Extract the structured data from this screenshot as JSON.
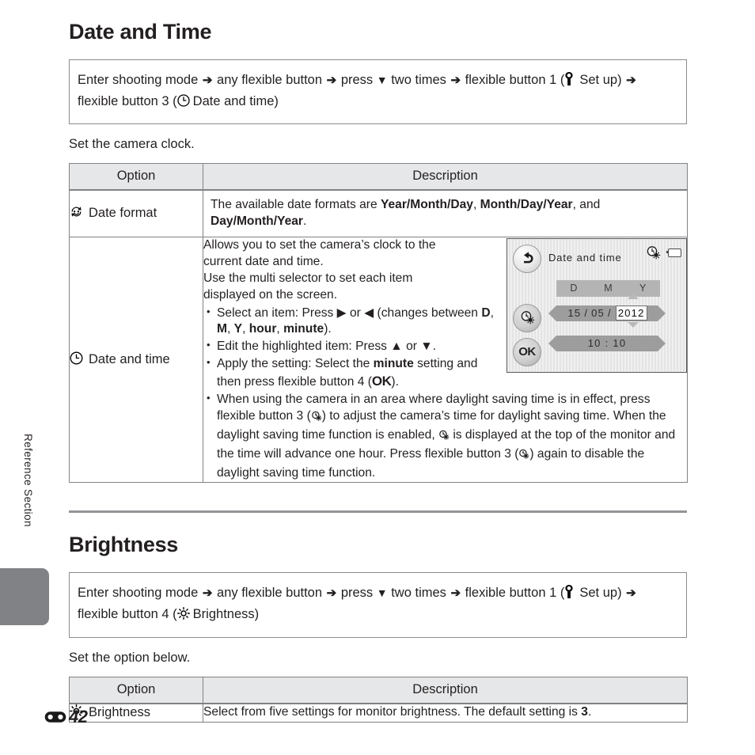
{
  "sidebar": {
    "label": "Reference Section"
  },
  "footer": {
    "section_symbol": "E",
    "page_number": "42"
  },
  "sections": [
    {
      "title": "Date and Time",
      "path": {
        "p1": "Enter shooting mode",
        "p2": "any flexible button",
        "p3": "press",
        "p3b": "two times",
        "p4": "flexible button 1",
        "p5": "Set up)",
        "p5_open": "(",
        "p6": "flexible button 3 (",
        "p7": "Date and time)",
        "arrow": "➔",
        "down_triangle": "▼"
      },
      "lead": "Set the camera clock.",
      "table": {
        "headers": [
          "Option",
          "Description"
        ],
        "rows": [
          {
            "icon": "date-format-icon",
            "option": "Date format",
            "desc_a": "The available date formats are ",
            "desc_b1": "Year/Month/Day",
            "desc_b1_sep": ", ",
            "desc_b2": "Month/Day/Year",
            "desc_b2_sep": ", and ",
            "desc_b3": "Day/Month/Year",
            "desc_end": "."
          },
          {
            "icon": "clock-icon",
            "option": "Date and time",
            "intro_l1": "Allows you to set the camera’s clock to the",
            "intro_l2": "current date and time.",
            "intro_l3": "Use the multi selector to set each item",
            "intro_l4": "displayed on the screen.",
            "bullets": {
              "b1_a": "Select an item: Press ",
              "b1_right": "▶",
              "b1_b": " or ",
              "b1_left": "◀",
              "b1_c": " (changes between ",
              "b1_D": "D",
              "b1_M": "M",
              "b1_Y": "Y",
              "b1_hour": "hour",
              "b1_minute": "minute",
              "b1_end": ").",
              "b2_a": "Edit the highlighted item: Press ",
              "b2_up": "▲",
              "b2_b": " or ",
              "b2_down": "▼",
              "b2_end": ".",
              "b3_a": "Apply the setting: Select the ",
              "b3_minute": "minute",
              "b3_b": " setting and then press flexible button 4 (",
              "b3_ok": "OK",
              "b3_end": ").",
              "b4_a": "When using the camera in an area where daylight saving time is in effect, press flexible button 3 (",
              "b4_b": ") to adjust the camera’s time for daylight saving time. When the daylight saving time function is enabled, ",
              "b4_c": " is displayed at the top of the monitor and the time will advance one hour. Press flexible button 3 (",
              "b4_d": ") again to disable the daylight saving time function."
            },
            "camera_screen": {
              "title": "Date and time",
              "back_icon": "back-arrow-icon",
              "dst_icon": "daylight-saving-icon",
              "battery_icon": "battery-icon",
              "ok_label": "OK",
              "columns": [
                "D",
                "M",
                "Y"
              ],
              "day": "15",
              "sep1": "/",
              "month": "05",
              "sep2": "/",
              "year": "2012",
              "hour": "10",
              "time_sep": ":",
              "minute": "10"
            }
          }
        ]
      }
    },
    {
      "title": "Brightness",
      "path": {
        "p1": "Enter shooting mode",
        "p2": "any flexible button",
        "p3": "press",
        "p3b": "two times",
        "p4": "flexible button 1",
        "p5": "Set up)",
        "p5_open": "(",
        "p6": "flexible button 4 (",
        "p7": "Brightness)",
        "arrow": "➔",
        "down_triangle": "▼"
      },
      "lead": "Set the option below.",
      "table": {
        "headers": [
          "Option",
          "Description"
        ],
        "rows": [
          {
            "icon": "brightness-icon",
            "option": "Brightness",
            "desc_a": "Select from five settings for monitor brightness. The default setting is ",
            "desc_b": "3",
            "desc_end": "."
          }
        ]
      }
    }
  ]
}
